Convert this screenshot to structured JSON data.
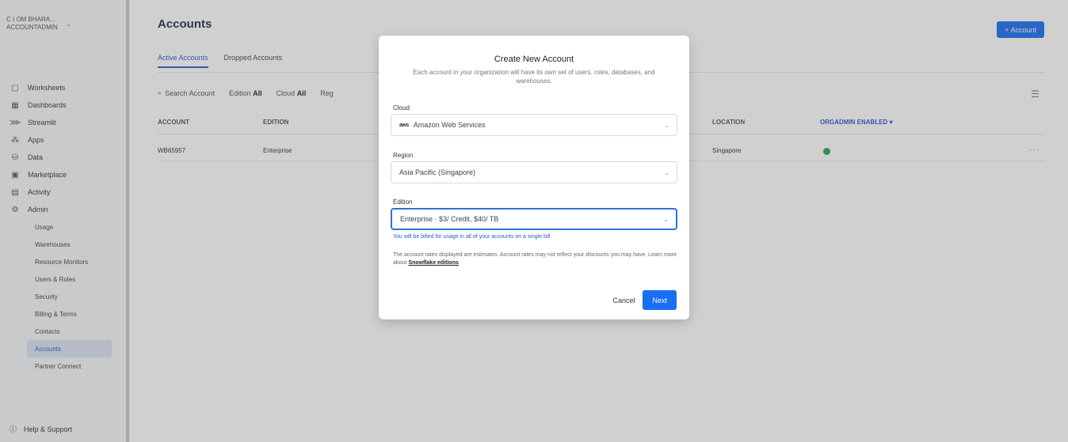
{
  "org": {
    "line1": "C I OM BHARA...",
    "line2": "ACCOUNTADMIN"
  },
  "sidebar": {
    "items": [
      {
        "icon": "worksheets-icon",
        "glyph": "▢",
        "label": "Worksheets"
      },
      {
        "icon": "dashboards-icon",
        "glyph": "▦",
        "label": "Dashboards"
      },
      {
        "icon": "streamlit-icon",
        "glyph": "⋙",
        "label": "Streamlit"
      },
      {
        "icon": "apps-icon",
        "glyph": "⁂",
        "label": "Apps"
      },
      {
        "icon": "data-icon",
        "glyph": "⛁",
        "label": "Data"
      },
      {
        "icon": "marketplace-icon",
        "glyph": "▣",
        "label": "Marketplace"
      },
      {
        "icon": "activity-icon",
        "glyph": "▤",
        "label": "Activity"
      },
      {
        "icon": "admin-icon",
        "glyph": "⚙",
        "label": "Admin"
      }
    ],
    "admin_sub": [
      "Usage",
      "Warehouses",
      "Resource Monitors",
      "Users & Roles",
      "Security",
      "Billing & Terms",
      "Contacts",
      "Accounts",
      "Partner Connect"
    ],
    "active_sub": "Accounts",
    "help": "Help & Support"
  },
  "main": {
    "title": "Accounts",
    "add_button": "+ Account",
    "tabs": [
      "Active Accounts",
      "Dropped Accounts"
    ],
    "filters": {
      "search": "Search Account",
      "edition_label": "Edition",
      "edition_value": "All",
      "cloud_label": "Cloud",
      "cloud_value": "All",
      "region_label": "Reg"
    },
    "columns": [
      "ACCOUNT",
      "EDITION",
      "LOCATION",
      "ORGADMIN ENABLED"
    ],
    "rows": [
      {
        "account": "WB65957",
        "edition": "Enterprise",
        "location": "Singapore",
        "orgadmin": true
      }
    ]
  },
  "modal": {
    "title": "Create New Account",
    "description": "Each account in your organization will have its own set of users, roles, databases, and warehouses.",
    "cloud_label": "Cloud",
    "cloud_value": "Amazon Web Services",
    "cloud_badge": "aws",
    "region_label": "Region",
    "region_value": "Asia Pacific (Singapore)",
    "edition_label": "Edition",
    "edition_value": "Enterprise · $3/ Credit, $40/ TB",
    "edition_hint": "You will be billed for usage in all of your accounts on a single bill",
    "note_prefix": "The account rates displayed are estimates. Account rates may not reflect your discounts you may have. Learn more about ",
    "note_link": "Snowflake editions",
    "cancel": "Cancel",
    "next": "Next"
  },
  "colors": {
    "accent": "#1a6ff0",
    "status_green": "#26a55b"
  }
}
